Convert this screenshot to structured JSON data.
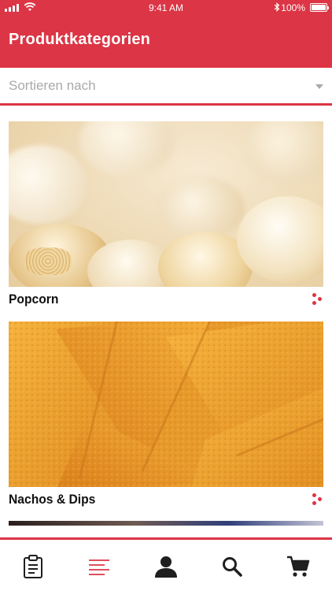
{
  "status_bar": {
    "time": "9:41 AM",
    "battery": "100%",
    "icons": [
      "signal-icon",
      "wifi-icon",
      "bluetooth-icon",
      "battery-icon"
    ]
  },
  "header": {
    "title": "Produktkategorien"
  },
  "sort": {
    "placeholder": "Sortieren nach",
    "icon": "chevron-down-icon"
  },
  "categories": [
    {
      "name": "Popcorn",
      "image": "popcorn-photo",
      "menu_icon": "more-dots-icon"
    },
    {
      "name": "Nachos & Dips",
      "image": "nachos-photo",
      "menu_icon": "more-dots-icon"
    }
  ],
  "tab_bar": {
    "items": [
      {
        "icon": "clipboard-icon",
        "active": false
      },
      {
        "icon": "menu-list-icon",
        "active": true
      },
      {
        "icon": "user-icon",
        "active": false
      },
      {
        "icon": "search-icon",
        "active": false
      },
      {
        "icon": "cart-icon",
        "active": false
      }
    ]
  },
  "colors": {
    "accent": "#dc3545",
    "placeholder": "#a9a9a9",
    "tab_icon": "#1f1f1f"
  }
}
